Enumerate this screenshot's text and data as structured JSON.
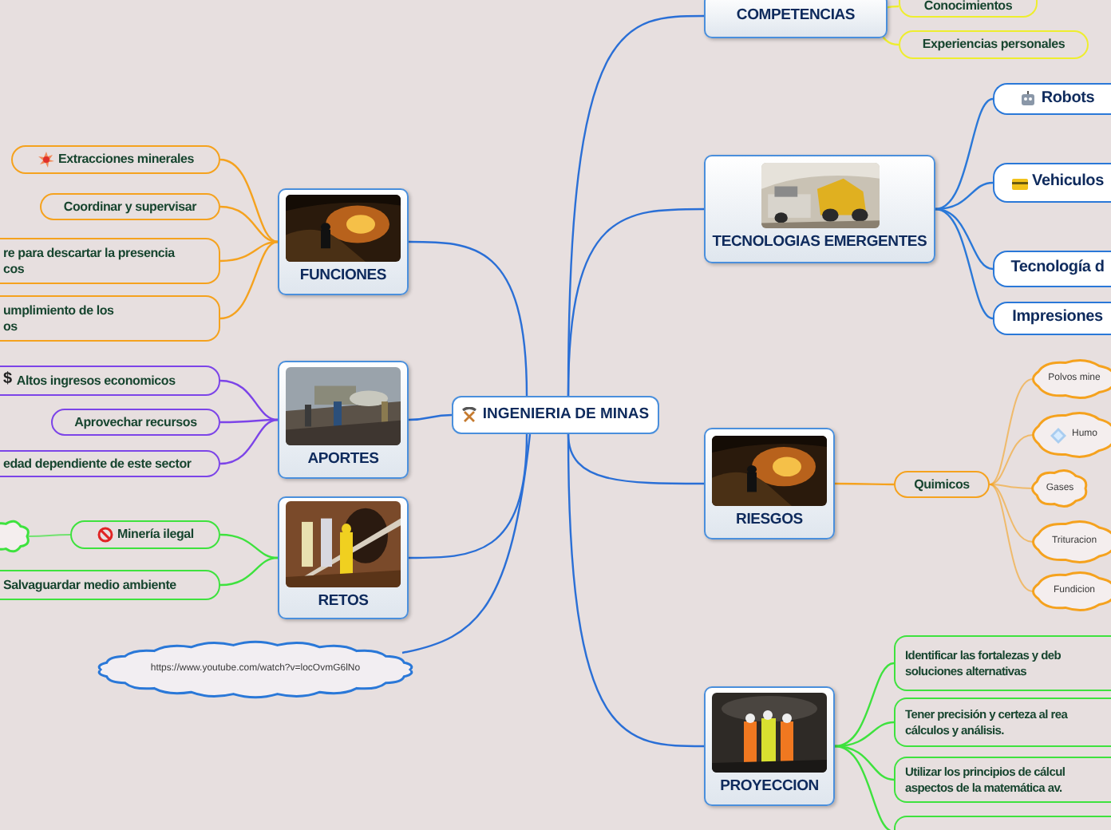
{
  "map": {
    "root": {
      "text": "INGENIERIA DE MINAS"
    },
    "branches": [
      {
        "kind": "topic",
        "text": "FUNCIONES",
        "color": "#f5a21e",
        "image": {
          "kind": "picture"
        },
        "children": [
          {
            "kind": "pill",
            "text": "Extracciones minerales"
          },
          {
            "kind": "pill",
            "text": "Coordinar y supervisar"
          },
          {
            "kind": "pill",
            "text": "re para descartar la presencia\ncos"
          },
          {
            "kind": "pill",
            "text": "umplimiento de los\nos"
          }
        ]
      },
      {
        "kind": "topic",
        "text": "APORTES",
        "color": "#7c44e8",
        "image": {
          "kind": "picture"
        },
        "children": [
          {
            "kind": "pill",
            "text": "Altos ingresos economicos",
            "symbol": "$"
          },
          {
            "kind": "pill",
            "text": "Aprovechar recursos"
          },
          {
            "kind": "pill",
            "text": "edad dependiente de este sector"
          }
        ]
      },
      {
        "kind": "topic",
        "text": "RETOS",
        "color": "#3ee23e",
        "image": {
          "kind": "picture"
        },
        "children": [
          {
            "kind": "pill",
            "text": "Minería ilegal",
            "children": [
              {
                "kind": "cloud"
              }
            ]
          },
          {
            "kind": "pill",
            "text": "Salvaguardar medio ambiente"
          }
        ]
      },
      {
        "kind": "topic",
        "text": "COMPETENCIAS",
        "color": "#eeee2e",
        "children": [
          {
            "kind": "pill",
            "text": "Conocimientos"
          },
          {
            "kind": "pill",
            "text": "Experiencias personales"
          }
        ]
      },
      {
        "kind": "topic",
        "text": "TECNOLOGIAS EMERGENTES",
        "color": "#2a78d8",
        "image": {
          "kind": "picture"
        },
        "children": [
          {
            "kind": "pill",
            "text": "Robots"
          },
          {
            "kind": "pill",
            "text": "Vehiculos"
          },
          {
            "kind": "pill",
            "text": "Tecnología d"
          },
          {
            "kind": "pill",
            "text": "Impresiones"
          }
        ]
      },
      {
        "kind": "topic",
        "text": "RIESGOS",
        "color": "#f5a21e",
        "image": {
          "kind": "picture"
        },
        "children": [
          {
            "kind": "pill",
            "text": "Quimicos",
            "children": [
              {
                "kind": "cloud",
                "text": "Polvos mine"
              },
              {
                "kind": "cloud",
                "text": "Humo"
              },
              {
                "kind": "cloud",
                "text": "Gases"
              },
              {
                "kind": "cloud",
                "text": "Trituracion"
              },
              {
                "kind": "cloud",
                "text": "Fundicion"
              }
            ]
          }
        ]
      },
      {
        "kind": "topic",
        "text": "PROYECCION",
        "color": "#3ee23e",
        "image": {
          "kind": "picture"
        },
        "children": [
          {
            "kind": "box",
            "text": "Identificar las fortalezas y deb\nsoluciones alternativas"
          },
          {
            "kind": "box",
            "text": "Tener precisión y certeza al rea\ncálculos y análisis."
          },
          {
            "kind": "box",
            "text": "Utilizar los principios de cálcul\naspectos de la matemática av."
          },
          {
            "kind": "box"
          }
        ]
      },
      {
        "kind": "cloud",
        "text": "https://www.youtube.com/watch?v=locOvmG6lNo",
        "color": "#2a78d8"
      }
    ]
  }
}
